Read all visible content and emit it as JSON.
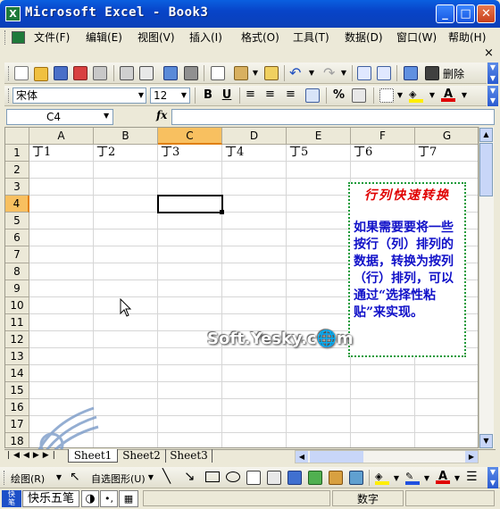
{
  "window": {
    "title": "Microsoft Excel - Book3",
    "app_icon": "X",
    "minimize_glyph": "_",
    "maximize_glyph": "□",
    "close_glyph": "✕"
  },
  "menu": {
    "items": [
      "文件(F)",
      "编辑(E)",
      "视图(V)",
      "插入(I)",
      "格式(O)",
      "工具(T)",
      "数据(D)",
      "窗口(W)",
      "帮助(H)"
    ],
    "close_glyph": "×"
  },
  "toolbar": {
    "delete_label": "删除"
  },
  "format": {
    "font_name": "宋体",
    "font_size": "12",
    "bold": "B",
    "underline": "U",
    "percent": "%",
    "accent_fill": "#ffee00",
    "accent_font": "#e00000"
  },
  "formula": {
    "name_box": "C4",
    "fx": "fx"
  },
  "grid": {
    "columns": [
      "A",
      "B",
      "C",
      "D",
      "E",
      "F",
      "G"
    ],
    "active_column": "C",
    "rows": [
      "1",
      "2",
      "3",
      "4",
      "5",
      "6",
      "7",
      "8",
      "9",
      "10",
      "11",
      "12",
      "13",
      "14",
      "15",
      "16",
      "17",
      "18"
    ],
    "active_row": "4",
    "row1_values": [
      "丁1",
      "丁2",
      "丁3",
      "丁4",
      "丁5",
      "丁6",
      "丁7"
    ]
  },
  "note": {
    "title": "行列快速转换",
    "body": "如果需要要将一些按行（列）排列的数据，转换为按列（行）排列，可以通过“选择性粘贴”来实现。"
  },
  "watermark": "Soft.Yesky.c🌐m",
  "sheets": {
    "tabs": [
      "Sheet1",
      "Sheet2",
      "Sheet3"
    ],
    "active": "Sheet1"
  },
  "drawing": {
    "draw_label": "绘图(R)",
    "autoshape_label": "自选图形(U)"
  },
  "status": {
    "ime_label": "快乐五笔",
    "mode": "数字"
  }
}
